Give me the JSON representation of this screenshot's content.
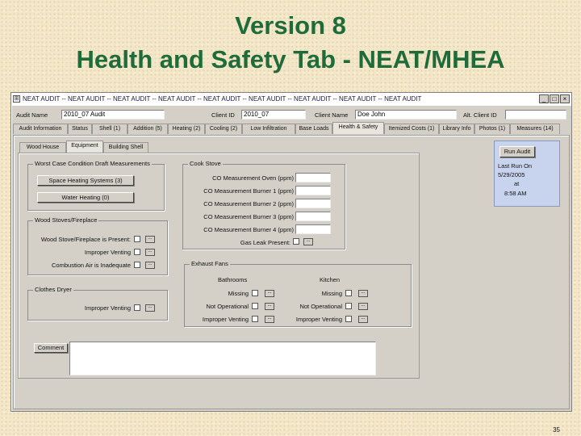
{
  "slide": {
    "title_line1": "Version 8",
    "title_line2": "Health and Safety Tab - NEAT/MHEA",
    "page_number": "35"
  },
  "window": {
    "title": "NEAT AUDIT -- NEAT AUDIT -- NEAT AUDIT -- NEAT AUDIT -- NEAT AUDIT -- NEAT AUDIT -- NEAT AUDIT -- NEAT AUDIT -- NEAT AUDIT",
    "controls": [
      "_",
      "□",
      "×"
    ]
  },
  "header": {
    "audit_name_label": "Audit Name",
    "audit_name_value": "2010_07 Audit",
    "client_id_label": "Client ID",
    "client_id_value": "2010_07",
    "client_name_label": "Client Name",
    "client_name_value": "Doe John",
    "alt_client_id_label": "Alt. Client ID",
    "alt_client_id_value": ""
  },
  "main_tabs": [
    "Audit Information",
    "Status",
    "Shell (1)",
    "Addition (5)",
    "Heating (2)",
    "Cooling (2)",
    "Low Infiltration",
    "Base Loads",
    "Health & Safety",
    "Itemized Costs (1)",
    "Library Info",
    "Photos (1)",
    "Measures (14)"
  ],
  "sub_tabs": [
    "Wood House",
    "Equipment",
    "Building Shell"
  ],
  "worst_case": {
    "title": "Worst Case Condition Draft Measurements",
    "space_heating_button": "Space Heating Systems (3)",
    "water_heating_button": "Water Heating (0)"
  },
  "cook_stove": {
    "title": "Cook Stove",
    "rows": [
      {
        "label": "CO Measurement Oven (ppm)",
        "value": ""
      },
      {
        "label": "CO Measurement Burner 1 (ppm)",
        "value": ""
      },
      {
        "label": "CO Measurement Burner 2 (ppm)",
        "value": ""
      },
      {
        "label": "CO Measurement Burner 3 (ppm)",
        "value": ""
      },
      {
        "label": "CO Measurement Burner 4 (ppm)",
        "value": ""
      }
    ],
    "gas_leak_label": "Gas Leak Present:"
  },
  "wood_stoves": {
    "title": "Wood Stoves/Fireplace",
    "rows": [
      "Wood Stove/Fireplace is Present:",
      "Improper Venting",
      "Combustion Air is Inadequate"
    ]
  },
  "clothes_dryer": {
    "title": "Clothes Dryer",
    "rows": [
      "Improper Venting"
    ]
  },
  "exhaust_fans": {
    "title": "Exhaust Fans",
    "bathroom_header": "Bathrooms",
    "kitchen_header": "Kitchen",
    "bathroom_rows": [
      "Missing",
      "Not Operational",
      "Improper Venting"
    ],
    "kitchen_rows": [
      "Missing",
      "Not Operational",
      "Improper Venting"
    ]
  },
  "comment": {
    "button": "Comment",
    "value": ""
  },
  "run_audit": {
    "button": "Run Audit",
    "last_run_label": "Last Run On",
    "last_run_date": "5/29/2005",
    "at_label": "at",
    "last_run_time": "8:58 AM"
  },
  "icons": {
    "lookup": "...",
    "window_icon": "⊞"
  }
}
